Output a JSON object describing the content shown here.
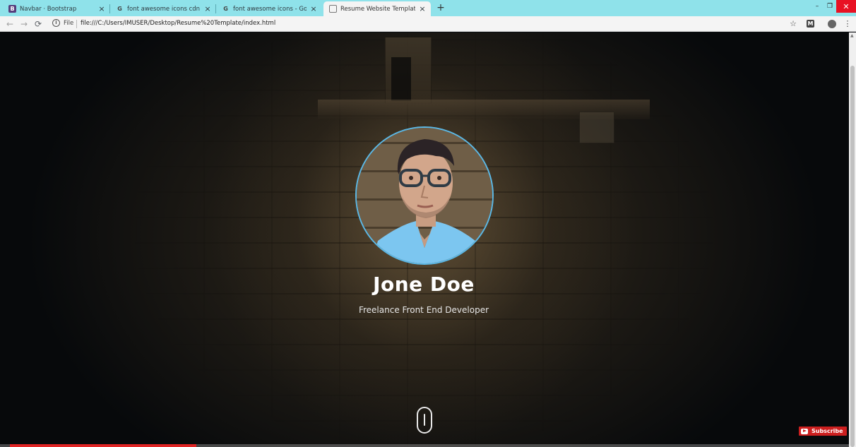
{
  "browser": {
    "tabs": [
      {
        "title": "Navbar · Bootstrap",
        "favicon": "B",
        "active": false
      },
      {
        "title": "font awesome icons cdn - Google",
        "favicon": "G",
        "active": false
      },
      {
        "title": "font awesome icons - Google Se",
        "favicon": "G",
        "active": false
      },
      {
        "title": "Resume Website Template",
        "favicon": "",
        "active": true
      }
    ],
    "new_tab_symbol": "+",
    "tab_close_symbol": "×",
    "window": {
      "minimize": "–",
      "maximize": "❐",
      "close": "✕"
    },
    "toolbar": {
      "back": "←",
      "forward": "→",
      "reload": "⟳",
      "info": "i",
      "scheme_label": "File",
      "url": "file:///C:/Users/IMUSER/Desktop/Resume%20Template/index.html",
      "bookmark": "☆",
      "extension": "M",
      "menu": "⋮"
    }
  },
  "hero": {
    "name": "Jone Doe",
    "subtitle": "Freelance Front End Developer",
    "scroll_icon": "mouse-scroll-icon"
  },
  "video": {
    "subscribe_label": "Subscribe",
    "progress": 0.22
  },
  "colors": {
    "tab_strip": "#8fe2ea",
    "avatar_border": "#5bb8e6",
    "subscribe": "#cc1f1f",
    "progress": "#e02424"
  }
}
